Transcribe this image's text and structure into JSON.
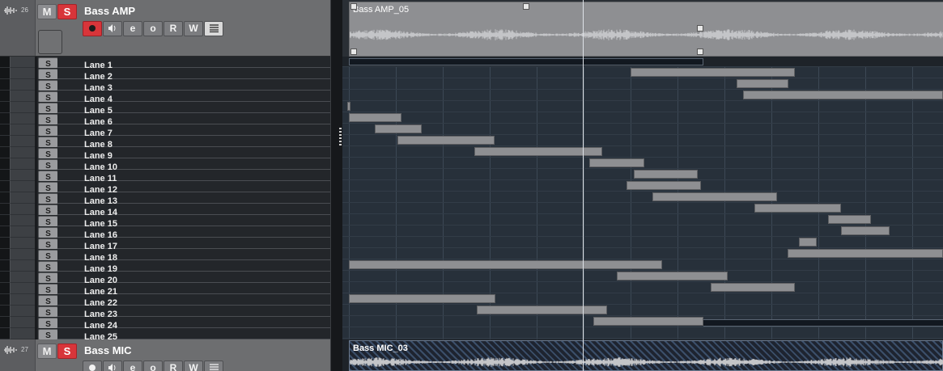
{
  "tracks": [
    {
      "number": "26",
      "name": "Bass AMP"
    },
    {
      "number": "27",
      "name": "Bass MIC"
    }
  ],
  "controls": {
    "mute": "M",
    "solo": "S",
    "read": "R",
    "write": "W",
    "edit_glyph": "e",
    "monitor_glyph": "o"
  },
  "lanes": [
    {
      "label": "Lane 1",
      "solo": "S"
    },
    {
      "label": "Lane 2",
      "solo": "S"
    },
    {
      "label": "Lane 3",
      "solo": "S"
    },
    {
      "label": "Lane 4",
      "solo": "S"
    },
    {
      "label": "Lane 5",
      "solo": "S"
    },
    {
      "label": "Lane 6",
      "solo": "S"
    },
    {
      "label": "Lane 7",
      "solo": "S"
    },
    {
      "label": "Lane 8",
      "solo": "S"
    },
    {
      "label": "Lane 9",
      "solo": "S"
    },
    {
      "label": "Lane 10",
      "solo": "S"
    },
    {
      "label": "Lane 11",
      "solo": "S"
    },
    {
      "label": "Lane 12",
      "solo": "S"
    },
    {
      "label": "Lane 13",
      "solo": "S"
    },
    {
      "label": "Lane 14",
      "solo": "S"
    },
    {
      "label": "Lane 15",
      "solo": "S"
    },
    {
      "label": "Lane 16",
      "solo": "S"
    },
    {
      "label": "Lane 17",
      "solo": "S"
    },
    {
      "label": "Lane 18",
      "solo": "S"
    },
    {
      "label": "Lane 19",
      "solo": "S"
    },
    {
      "label": "Lane 20",
      "solo": "S"
    },
    {
      "label": "Lane 21",
      "solo": "S"
    },
    {
      "label": "Lane 22",
      "solo": "S"
    },
    {
      "label": "Lane 23",
      "solo": "S"
    },
    {
      "label": "Lane 24",
      "solo": "S"
    },
    {
      "label": "Lane 25",
      "solo": "S"
    }
  ],
  "events": {
    "main": "Bass AMP_05",
    "mic": "Bass MIC_03"
  },
  "colors": {
    "solo_active": "#d8353a",
    "record": "#d8353a",
    "track_header": "#6d6e70",
    "event": "#8e8f92",
    "lane_bg": "#27303a"
  },
  "icons": [
    "audio-track-icon",
    "record-icon",
    "speaker-icon",
    "edit-icon",
    "monitor-icon",
    "lanes-icon"
  ]
}
